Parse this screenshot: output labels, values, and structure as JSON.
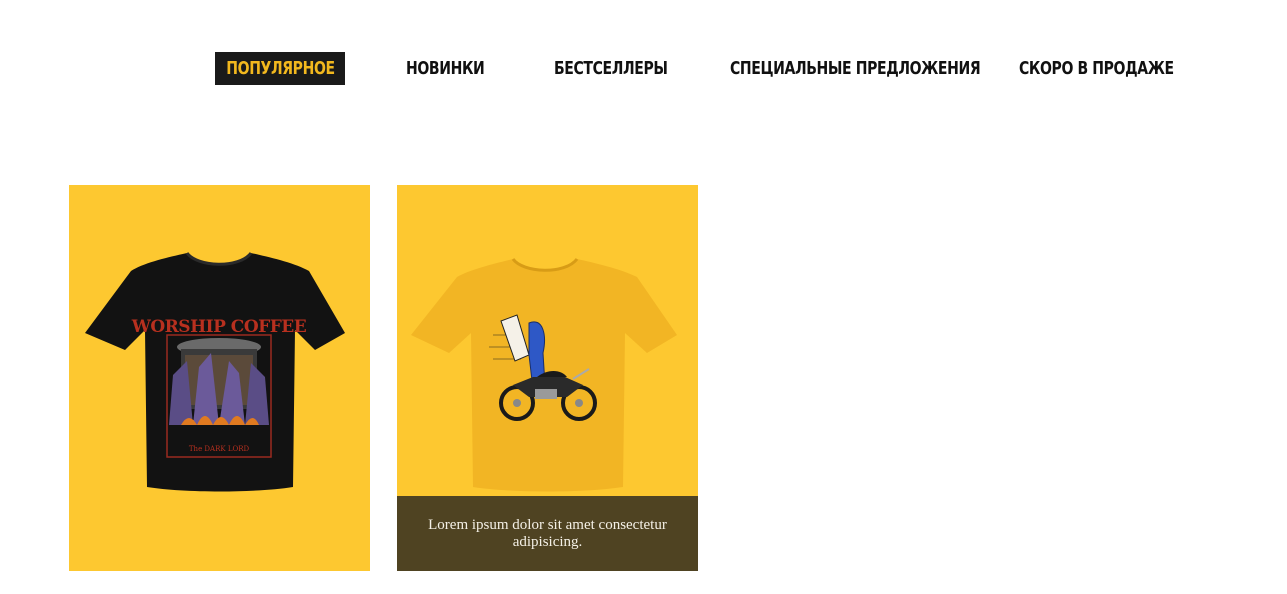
{
  "colors": {
    "accent": "#fdc830",
    "active_tab_bg": "#1a1a1a",
    "active_tab_text": "#f2b81e",
    "overlay_bg": "#4f4322"
  },
  "tabs": [
    {
      "label": "ПОПУЛЯРНОЕ",
      "active": true
    },
    {
      "label": "НОВИНКИ",
      "active": false
    },
    {
      "label": "БЕСТСЕЛЛЕРЫ",
      "active": false
    },
    {
      "label": "СПЕЦИАЛЬНЫЕ ПРЕДЛОЖЕНИЯ",
      "active": false
    },
    {
      "label": "СКОРО В ПРОДАЖЕ",
      "active": false
    }
  ],
  "products": [
    {
      "image_icon": "black-tshirt-worship-coffee",
      "print_title": "WORSHIP COFFEE",
      "print_subtitle": "The DARK LORD"
    },
    {
      "image_icon": "yellow-tshirt-motorcycle",
      "caption": "Lorem ipsum dolor sit amet consectetur adipisicing."
    }
  ]
}
